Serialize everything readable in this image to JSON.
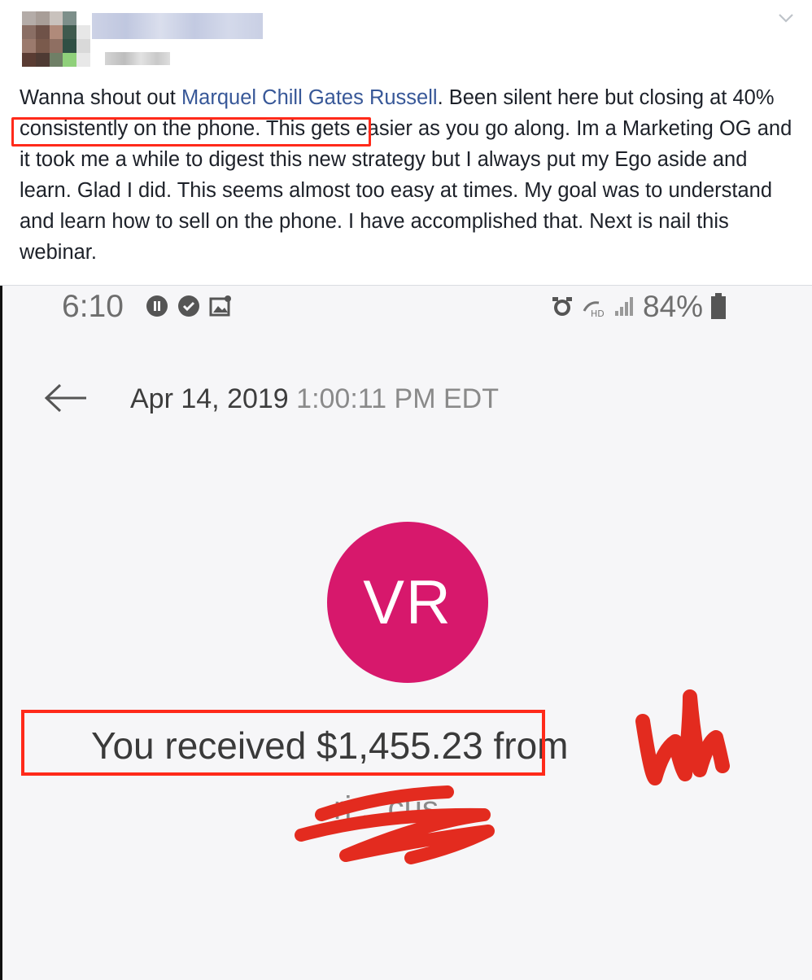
{
  "post": {
    "text_before": "Wanna shout out ",
    "mention": "Marquel Chill Gates Russell",
    "text_after_mention": ". Been silent here but closing ",
    "highlight": "at 40% consistently on the phone.",
    "text_rest": " This gets easier as you go along. Im a Marketing OG and it took me a while to digest this new strategy but I always put my Ego aside and learn. Glad I did. This seems almost too easy at times. My goal was to understand and learn how to sell on the phone. I have accomplished that. Next is nail this webinar."
  },
  "icons": {
    "options": "chevron-down-icon",
    "back": "back-arrow-icon"
  },
  "phone": {
    "status": {
      "time": "6:10",
      "battery": "84%"
    },
    "transaction": {
      "date": "Apr 14, 2019",
      "time": "1:00:11 PM EDT",
      "initials": "VR",
      "received": "You received $1,455.23 from",
      "name_fragment": "ri    ...cus"
    }
  },
  "colors": {
    "accent_link": "#385898",
    "highlight_box": "#ff2a1a",
    "avatar_bg": "#d7186c"
  }
}
